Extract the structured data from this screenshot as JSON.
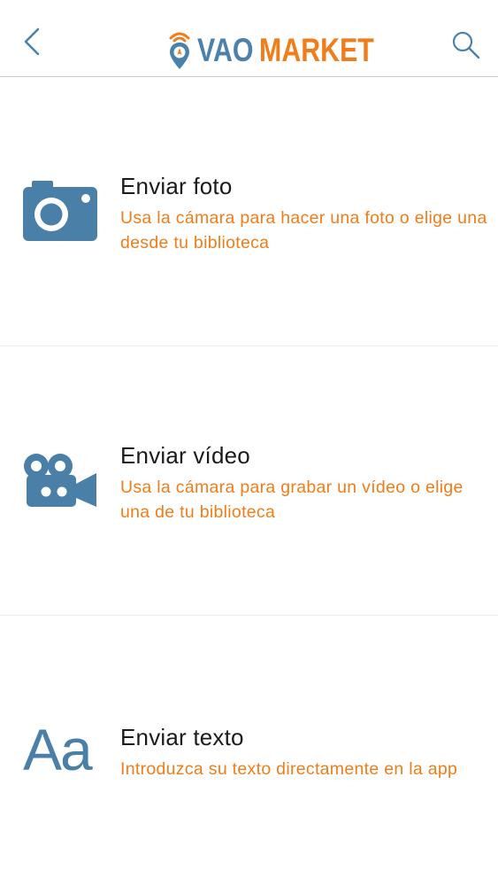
{
  "header": {
    "back_icon": "chevron-left-icon",
    "search_icon": "search-icon",
    "logo": {
      "part1": "VAO",
      "part2": "MARKET"
    }
  },
  "colors": {
    "accent_blue": "#4a82ad",
    "accent_orange": "#f07d19",
    "title_text": "#1b1b1b"
  },
  "options": [
    {
      "icon": "camera-icon",
      "title": "Enviar foto",
      "description": "Usa la cámara para hacer una foto o elige una desde tu biblioteca"
    },
    {
      "icon": "video-camera-icon",
      "title": "Enviar vídeo",
      "description": "Usa la cámara para grabar un vídeo o elige una de tu biblioteca"
    },
    {
      "icon": "text-icon",
      "icon_text": "Aa",
      "title": "Enviar texto",
      "description": "Introduzca su texto directamente en la app"
    }
  ]
}
